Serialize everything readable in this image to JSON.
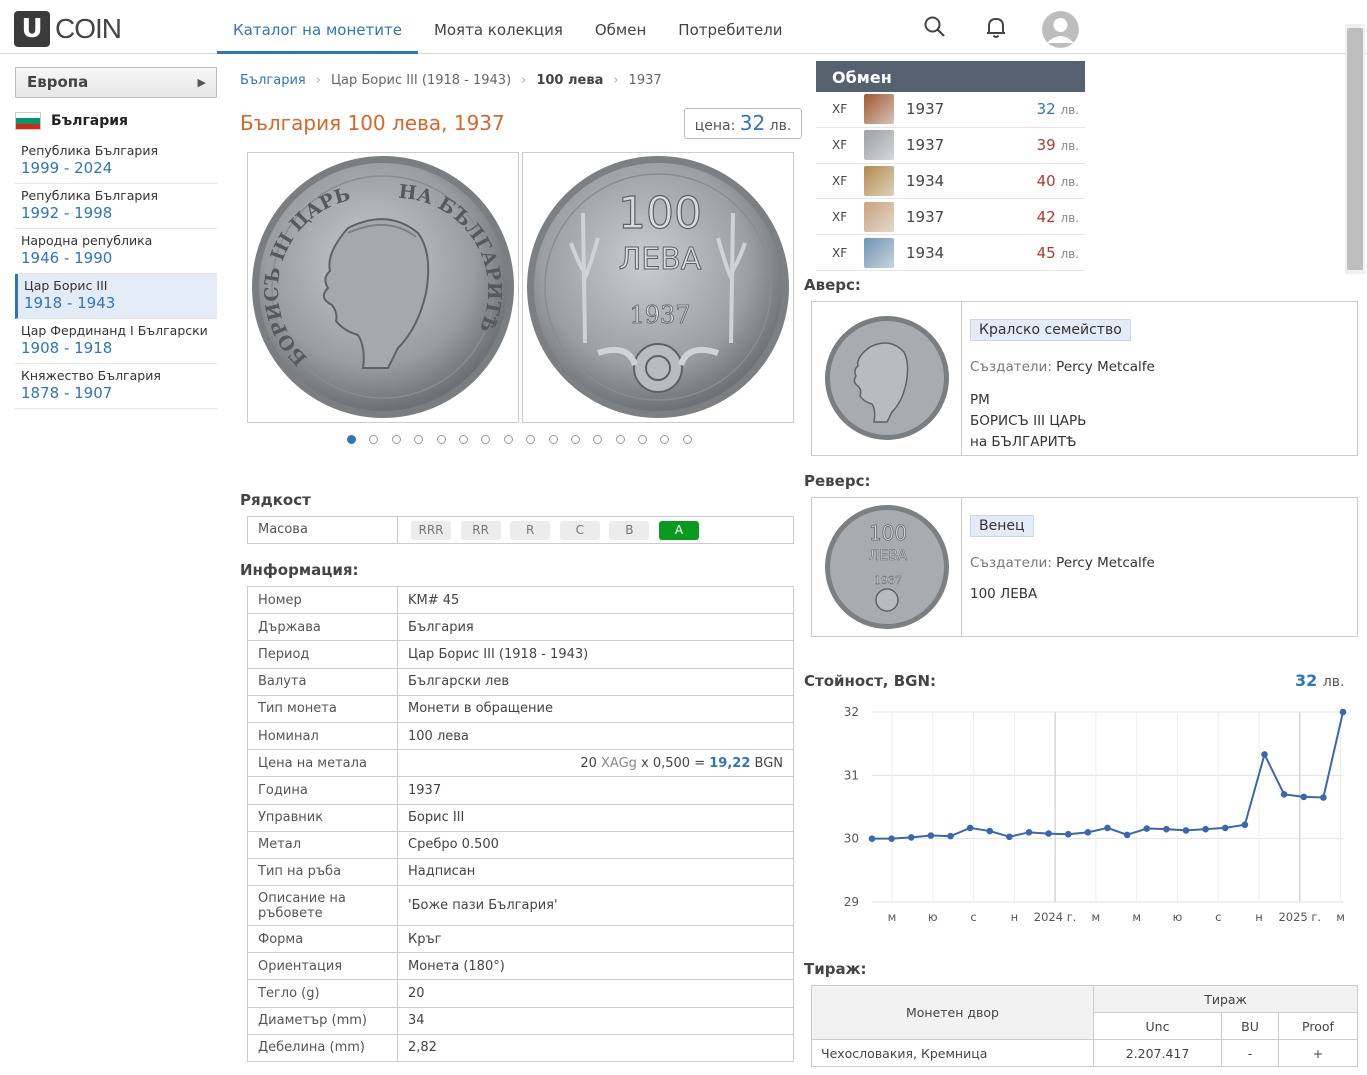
{
  "header": {
    "logo_letter": "U",
    "logo_text": "COIN",
    "nav": [
      "Каталог на монетите",
      "Моята колекция",
      "Обмен",
      "Потребители"
    ],
    "icons": [
      "search-icon",
      "bell-icon",
      "user-avatar-icon"
    ]
  },
  "sidebar": {
    "region": "Европа",
    "country": "България",
    "periods": [
      {
        "name": "Република България",
        "years": "1999 - 2024"
      },
      {
        "name": "Република България",
        "years": "1992 - 1998"
      },
      {
        "name": "Народна република",
        "years": "1946 - 1990"
      },
      {
        "name": "Цар Борис III",
        "years": "1918 - 1943"
      },
      {
        "name": "Цар Фердинанд I Български",
        "years": "1908 - 1918"
      },
      {
        "name": "Княжество България",
        "years": "1878 - 1907"
      }
    ]
  },
  "breadcrumb": [
    "България",
    "Цар Борис III (1918 - 1943)",
    "100 лева",
    "1937"
  ],
  "title": "България 100 лева, 1937",
  "price": {
    "label": "цена:",
    "value": "32",
    "unit": "лв."
  },
  "coin_images": {
    "obverse_legend": [
      "БОРИСЪ III ЦАРЬ",
      "НА БЪЛГАРИТѢ"
    ],
    "reverse_legend": [
      "100",
      "ЛЕВА",
      "1937"
    ]
  },
  "gallery_dots": 16,
  "rarity": {
    "heading": "Рядкост",
    "label": "Масова",
    "levels": [
      "RRR",
      "RR",
      "R",
      "C",
      "B",
      "A"
    ],
    "active": "A"
  },
  "info": {
    "heading": "Информация:",
    "rows": [
      {
        "k": "Номер",
        "v": "KM# 45"
      },
      {
        "k": "Държава",
        "v": "България"
      },
      {
        "k": "Период",
        "v": "Цар Борис III (1918 - 1943)"
      },
      {
        "k": "Валута",
        "v": "Български лев"
      },
      {
        "k": "Тип монета",
        "v": "Монети в обращение"
      },
      {
        "k": "Номинал",
        "v": "100 лева"
      },
      {
        "k": "Цена на метала",
        "metal": {
          "a": "20 ",
          "b": "XAGg",
          "c": " x 0,500 = ",
          "d": "19,22",
          "e": " BGN"
        }
      },
      {
        "k": "Година",
        "v": "1937"
      },
      {
        "k": "Управник",
        "v": "Борис III"
      },
      {
        "k": "Метал",
        "v": "Сребро 0.500"
      },
      {
        "k": "Тип на ръба",
        "v": "Надписан"
      },
      {
        "k": "Описание на ръбовете",
        "v": "'Боже пази България'"
      },
      {
        "k": "Форма",
        "v": "Кръг"
      },
      {
        "k": "Ориентация",
        "v": "Монета (180°)"
      },
      {
        "k": "Тегло (g)",
        "v": "20"
      },
      {
        "k": "Диаметър (mm)",
        "v": "34"
      },
      {
        "k": "Дебелина (mm)",
        "v": "2,82"
      }
    ]
  },
  "exchange": {
    "heading": "Обмен",
    "unit": "лв.",
    "rows": [
      {
        "grade": "XF",
        "year": "1937",
        "price": "32",
        "thumb": "#a0582e"
      },
      {
        "grade": "XF",
        "year": "1937",
        "price": "39",
        "thumb": "#9aa0a6"
      },
      {
        "grade": "XF",
        "year": "1934",
        "price": "40",
        "thumb": "#b48a4a"
      },
      {
        "grade": "XF",
        "year": "1937",
        "price": "42",
        "thumb": "#c9a27c"
      },
      {
        "grade": "XF",
        "year": "1934",
        "price": "45",
        "thumb": "#6e93b3"
      }
    ]
  },
  "obverse": {
    "heading": "Аверс:",
    "tag": "Кралско семейство",
    "creators_label": "Създатели:",
    "creators": "Percy Metcalfe",
    "lines": [
      "PM",
      "БОРИСЪ III ЦАРЬ",
      "на БЪЛГАРИТѢ"
    ]
  },
  "reverse": {
    "heading": "Реверс:",
    "tag": "Венец",
    "creators_label": "Създатели:",
    "creators": "Percy Metcalfe",
    "lines": [
      "100 ЛЕВА"
    ]
  },
  "value_chart": {
    "heading": "Стойност, BGN:",
    "current": "32",
    "unit": "лв."
  },
  "chart_data": {
    "type": "line",
    "ylim": [
      29,
      32
    ],
    "yticks": [
      "32",
      "31",
      "30",
      "29"
    ],
    "xticks": [
      "м",
      "ю",
      "с",
      "н",
      "2024 г.",
      "м",
      "м",
      "ю",
      "с",
      "н",
      "2025 г.",
      "м"
    ],
    "series": [
      {
        "values": [
          30.0,
          30.0,
          30.02,
          30.05,
          30.04,
          30.17,
          30.12,
          30.03,
          30.1,
          30.08,
          30.07,
          30.1,
          30.17,
          30.06,
          30.16,
          30.15,
          30.13,
          30.15,
          30.17,
          30.22,
          31.33,
          30.7,
          30.66,
          30.65,
          32.0
        ]
      }
    ],
    "grid": true
  },
  "mintage": {
    "heading": "Тираж:",
    "col_mint": "Монетен двор",
    "col_mintage": "Тираж",
    "sub": [
      "Unc",
      "BU",
      "Proof"
    ],
    "rows": [
      {
        "mint": "Чехословакия, Кремница",
        "unc": "2.207.417",
        "bu": "-",
        "proof": "+"
      }
    ]
  }
}
